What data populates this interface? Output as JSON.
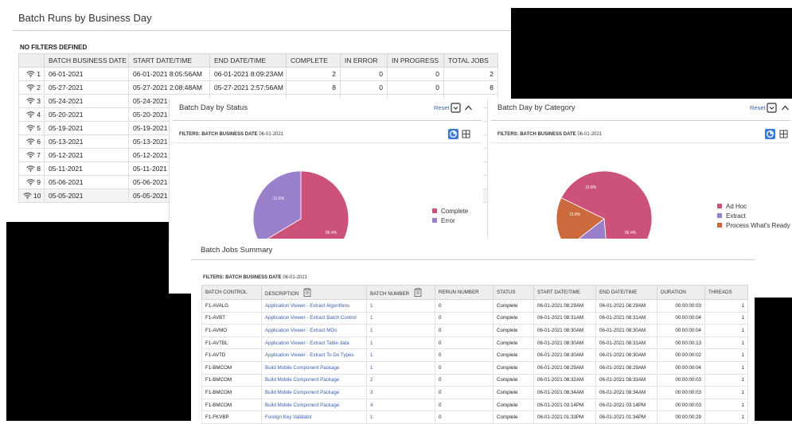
{
  "main": {
    "title": "Batch Runs by Business Day",
    "filters_label": "NO FILTERS DEFINED",
    "columns": [
      "",
      "BATCH BUSINESS DATE",
      "START DATE/TIME",
      "END DATE/TIME",
      "COMPLETE",
      "IN ERROR",
      "IN PROGRESS",
      "TOTAL JOBS"
    ],
    "rows": [
      {
        "idx": "1",
        "date": "06-01-2021",
        "start": "06-01-2021 8:05:56AM",
        "end": "06-01-2021 8:09:23AM",
        "complete": "2",
        "error": "0",
        "progress": "0",
        "total": "2"
      },
      {
        "idx": "2",
        "date": "05-27-2021",
        "start": "05-27-2021 2:08:48AM",
        "end": "05-27-2021 2:57:56AM",
        "complete": "8",
        "error": "0",
        "progress": "0",
        "total": "8"
      },
      {
        "idx": "3",
        "date": "05-24-2021",
        "start": "05-24-2021 1",
        "end": "",
        "complete": "",
        "error": "",
        "progress": "",
        "total": ""
      },
      {
        "idx": "4",
        "date": "05-20-2021",
        "start": "05-20-2021 3",
        "end": "",
        "complete": "",
        "error": "",
        "progress": "",
        "total": ""
      },
      {
        "idx": "5",
        "date": "05-19-2021",
        "start": "05-19-2021 1",
        "end": "",
        "complete": "",
        "error": "",
        "progress": "",
        "total": ""
      },
      {
        "idx": "6",
        "date": "05-13-2021",
        "start": "05-13-2021 6",
        "end": "",
        "complete": "",
        "error": "",
        "progress": "",
        "total": ""
      },
      {
        "idx": "7",
        "date": "05-12-2021",
        "start": "05-12-2021 6",
        "end": "",
        "complete": "",
        "error": "",
        "progress": "",
        "total": ""
      },
      {
        "idx": "8",
        "date": "05-11-2021",
        "start": "05-11-2021 6",
        "end": "",
        "complete": "",
        "error": "",
        "progress": "",
        "total": ""
      },
      {
        "idx": "9",
        "date": "05-06-2021",
        "start": "05-06-2021 1",
        "end": "",
        "complete": "",
        "error": "",
        "progress": "",
        "total": ""
      },
      {
        "idx": "10",
        "date": "05-05-2021",
        "start": "05-05-2021 1",
        "end": "",
        "complete": "",
        "error": "",
        "progress": "",
        "total": ""
      }
    ]
  },
  "status_panel": {
    "title": "Batch Day by Status",
    "reset": "Reset",
    "filters_label": "FILTERS: BATCH BUSINESS DATE",
    "filters_value": "06-01-2021",
    "icons": [
      "filter-dropdown-icon",
      "collapse-icon",
      "pie-chart-icon",
      "grid-icon"
    ]
  },
  "category_panel": {
    "title": "Batch Day by Category",
    "reset": "Reset",
    "filters_label": "FILTERS: BATCH BUSINESS DATE",
    "filters_value": "06-01-2021",
    "icons": [
      "filter-dropdown-icon",
      "collapse-icon",
      "pie-chart-icon",
      "grid-icon"
    ]
  },
  "chart_data": [
    {
      "type": "pie",
      "title": "Batch Day by Status",
      "categories": [
        "Complete",
        "Error"
      ],
      "values": [
        66.4,
        33.6
      ],
      "labels": [
        "66.4%",
        "31.6%"
      ],
      "colors": [
        "#cd5279",
        "#9a7fcb"
      ]
    },
    {
      "type": "pie",
      "title": "Batch Day by Category",
      "categories": [
        "Ad Hoc",
        "Extract",
        "Process What's Ready"
      ],
      "values": [
        66.4,
        15.8,
        17.8
      ],
      "labels": [
        "66.4%",
        "15.8%",
        "15.8%"
      ],
      "colors": [
        "#cd5279",
        "#9a7fcb",
        "#cc6a3e"
      ]
    }
  ],
  "jobs": {
    "title": "Batch Jobs Summary",
    "filters_label": "FILTERS: BATCH BUSINESS DATE",
    "filters_value": "06-01-2021",
    "columns": [
      "BATCH CONTROL",
      "DESCRIPTION",
      "BATCH NUMBER",
      "RERUN NUMBER",
      "STATUS",
      "START DATE/TIME",
      "END DATE/TIME",
      "DURATION",
      "THREADS"
    ],
    "rows": [
      {
        "control": "F1-AVALG",
        "desc": "Application Viewer - Extract Algorithms",
        "batch": "1",
        "rerun": "0",
        "status": "Complete",
        "start": "06-01-2021 08:29AM",
        "end": "06-01-2021 08:29AM",
        "duration": "00:00:00:03",
        "threads": "1"
      },
      {
        "control": "F1-AVBT",
        "desc": "Application Viewer - Extract Batch Control",
        "batch": "1",
        "rerun": "0",
        "status": "Complete",
        "start": "06-01-2021 08:31AM",
        "end": "06-01-2021 08:31AM",
        "duration": "00:00:00:04",
        "threads": "1"
      },
      {
        "control": "F1-AVMO",
        "desc": "Application Viewer - Extract MOs",
        "batch": "1",
        "rerun": "0",
        "status": "Complete",
        "start": "06-01-2021 08:30AM",
        "end": "06-01-2021 08:30AM",
        "duration": "00:00:00:04",
        "threads": "1"
      },
      {
        "control": "F1-AVTBL",
        "desc": "Application Viewer - Extract Table data",
        "batch": "1",
        "rerun": "0",
        "status": "Complete",
        "start": "06-01-2021 08:30AM",
        "end": "06-01-2021 08:31AM",
        "duration": "00:00:00:13",
        "threads": "1"
      },
      {
        "control": "F1-AVTD",
        "desc": "Application Viewer - Extract To Do Types",
        "batch": "1",
        "rerun": "0",
        "status": "Complete",
        "start": "06-01-2021 08:30AM",
        "end": "06-01-2021 08:30AM",
        "duration": "00:00:00:02",
        "threads": "1"
      },
      {
        "control": "F1-BMCOM",
        "desc": "Build Mobile Component Package",
        "batch": "1",
        "rerun": "0",
        "status": "Complete",
        "start": "06-01-2021 08:29AM",
        "end": "06-01-2021 08:29AM",
        "duration": "00:00:00:04",
        "threads": "1"
      },
      {
        "control": "F1-BMCOM",
        "desc": "Build Mobile Component Package",
        "batch": "2",
        "rerun": "0",
        "status": "Complete",
        "start": "06-01-2021 08:32AM",
        "end": "06-01-2021 08:33AM",
        "duration": "00:00:00:03",
        "threads": "1"
      },
      {
        "control": "F1-BMCOM",
        "desc": "Build Mobile Component Package",
        "batch": "3",
        "rerun": "0",
        "status": "Complete",
        "start": "06-01-2021 08:34AM",
        "end": "06-01-2021 08:34AM",
        "duration": "00:00:00:03",
        "threads": "1"
      },
      {
        "control": "F1-BMCOM",
        "desc": "Build Mobile Component Package",
        "batch": "4",
        "rerun": "0",
        "status": "Complete",
        "start": "06-01-2021 03:14PM",
        "end": "06-01-2021 03:14PM",
        "duration": "00:00:00:03",
        "threads": "1"
      },
      {
        "control": "F1-FKVBP",
        "desc": "Foreign Key Validator",
        "batch": "1",
        "rerun": "0",
        "status": "Complete",
        "start": "06-01-2021 01:33PM",
        "end": "06-01-2021 01:34PM",
        "duration": "00:00:00:29",
        "threads": "1"
      }
    ]
  }
}
